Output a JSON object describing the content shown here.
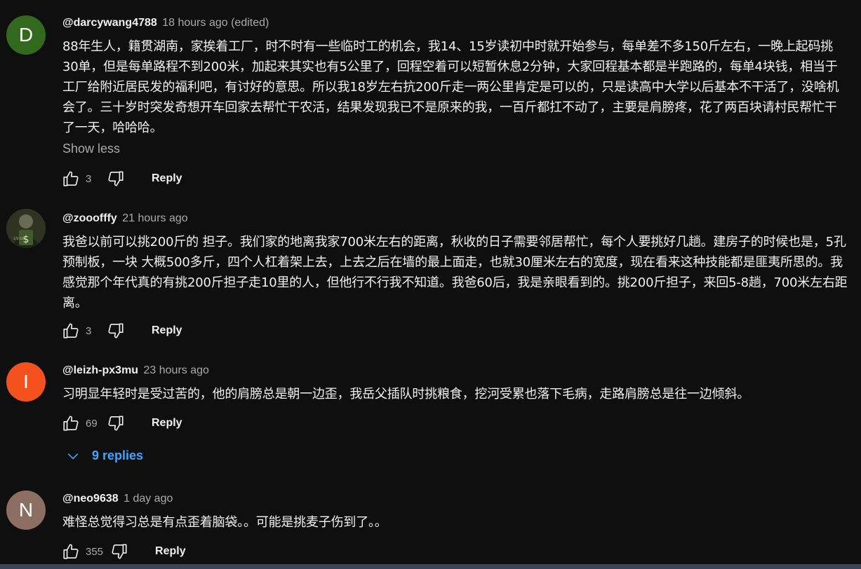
{
  "comments": [
    {
      "avatar_letter": "D",
      "avatar_color": "#33691e",
      "author": "@darcywang4788",
      "time": "18 hours ago (edited)",
      "text": "88年生人，籍贯湖南，家挨着工厂，时不时有一些临时工的机会，我14、15岁读初中时就开始参与，每单差不多150斤左右，一晚上起码挑30单，但是每单路程不到200米，加起来其实也有5公里了，回程空着可以短暂休息2分钟，大家回程基本都是半跑路的，每单4块钱，相当于工厂给附近居民发的福利吧，有讨好的意思。所以我18岁左右抗200斤走一两公里肯定是可以的，只是读高中大学以后基本不干活了，没啥机会了。三十岁时突发奇想开车回家去帮忙干农活，结果发现我已不是原来的我，一百斤都扛不动了，主要是肩膀疼，花了两百块请村民帮忙干了一天，哈哈哈。",
      "show_less": "Show less",
      "likes": "3",
      "reply_label": "Reply"
    },
    {
      "avatar_letter": "",
      "avatar_color": "#3a3a2a",
      "author": "@zooofffy",
      "time": "21 hours ago",
      "text": "我爸以前可以挑200斤的 担子。我们家的地离我家700米左右的距离，秋收的日子需要邻居帮忙，每个人要挑好几趟。建房子的时候也是，5孔预制板，一块 大概500多斤，四个人杠着架上去，上去之后在墙的最上面走，也就30厘米左右的宽度，现在看来这种技能都是匪夷所思的。我感觉那个年代真的有挑200斤担子走10里的人，但他行不行我不知道。我爸60后，我是亲眼看到的。挑200斤担子，来回5-8趟，700米左右距离。",
      "likes": "3",
      "reply_label": "Reply"
    },
    {
      "avatar_letter": "I",
      "avatar_color": "#f4511e",
      "author": "@leizh-px3mu",
      "time": "23 hours ago",
      "text": "习明显年轻时是受过苦的，他的肩膀总是朝一边歪，我岳父插队时挑粮食，挖河受累也落下毛病，走路肩膀总是往一边倾斜。",
      "likes": "69",
      "reply_label": "Reply",
      "replies_label": "9 replies"
    },
    {
      "avatar_letter": "N",
      "avatar_color": "#8d6e63",
      "author": "@neo9638",
      "time": "1 day ago",
      "text": "难怪总觉得习总是有点歪着脑袋。。可能是挑麦子伤到了。。",
      "likes": "355",
      "reply_label": "Reply"
    }
  ],
  "colors": {
    "background": "#0f0f0f",
    "text": "#f1f1f1",
    "secondary": "#aaaaaa",
    "link": "#3ea6ff"
  },
  "icons": [
    "thumb-up-icon",
    "thumb-down-icon",
    "chevron-down-icon"
  ]
}
